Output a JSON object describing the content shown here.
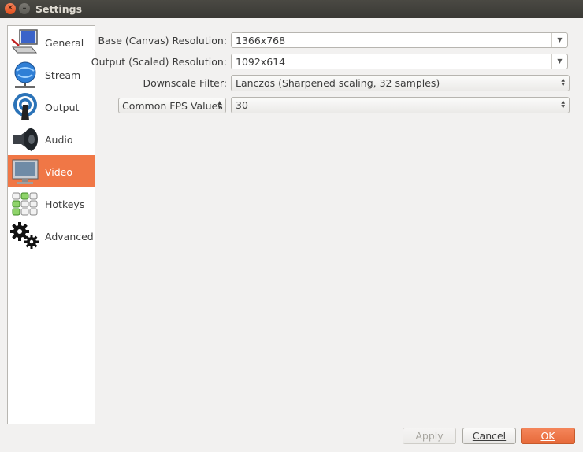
{
  "window": {
    "title": "Settings"
  },
  "sidebar": {
    "items": [
      {
        "label": "General",
        "icon": "monitor-keyboard-icon",
        "active": false
      },
      {
        "label": "Stream",
        "icon": "globe-network-icon",
        "active": false
      },
      {
        "label": "Output",
        "icon": "broadcast-antenna-icon",
        "active": false
      },
      {
        "label": "Audio",
        "icon": "speaker-icon",
        "active": false
      },
      {
        "label": "Video",
        "icon": "monitor-icon",
        "active": true
      },
      {
        "label": "Hotkeys",
        "icon": "keyboard-icon",
        "active": false
      },
      {
        "label": "Advanced",
        "icon": "gears-icon",
        "active": false
      }
    ]
  },
  "video": {
    "base_label": "Base (Canvas) Resolution:",
    "base_value": "1366x768",
    "output_label": "Output (Scaled) Resolution:",
    "output_value": "1092x614",
    "filter_label": "Downscale Filter:",
    "filter_value": "Lanczos (Sharpened scaling, 32 samples)",
    "fps_type": "Common FPS Values",
    "fps_value": "30"
  },
  "buttons": {
    "apply": "Apply",
    "cancel": "Cancel",
    "ok": "OK"
  },
  "colors": {
    "accent": "#f07746",
    "titlebar": "#3c3b37"
  }
}
